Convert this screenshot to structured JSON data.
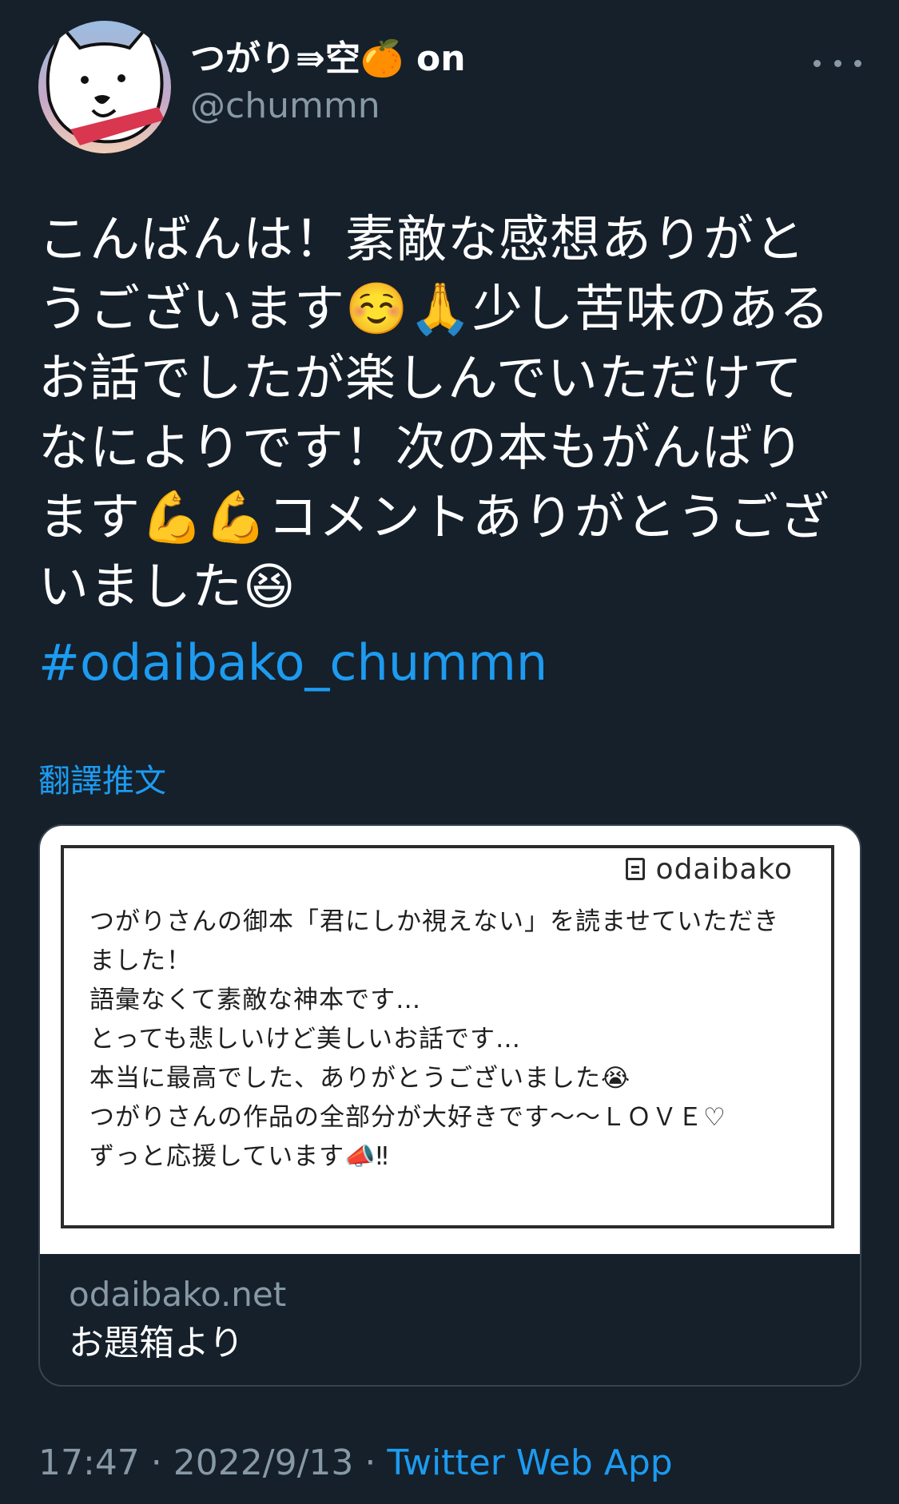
{
  "author": {
    "display_name": "つがり⇛空🍊 on",
    "handle": "@chummn"
  },
  "tweet": {
    "lines": [
      "こんばんは！素敵な感想ありがと",
      "うございます☺️🙏少し苦味のある",
      "お話でしたが楽しんでいただけて",
      "なによりです！次の本もがんばり",
      "ます💪💪コメントありがとうござ",
      "いました😆"
    ],
    "hashtag": "#odaibako_chummn",
    "translate_label": "翻譯推文"
  },
  "card": {
    "brand": "odaibako",
    "message_lines": [
      "つがりさんの御本「君にしか視えない」を読ませていただき",
      "ました！",
      "語彙なくて素敵な神本です…",
      "とっても悲しいけど美しいお話です…",
      "本当に最高でした、ありがとうございました😭",
      "つがりさんの作品の全部分が大好きです〜〜ＬＯＶＥ♡",
      "ずっと応援しています📣‼"
    ],
    "domain": "odaibako.net",
    "title": "お題箱より"
  },
  "meta": {
    "time": "17:47",
    "separator": " · ",
    "date": "2022/9/13",
    "source": "Twitter Web App"
  },
  "colors": {
    "background": "#15202b",
    "accent": "#1d9bf0",
    "muted": "#8899a6",
    "border": "#38444d"
  }
}
